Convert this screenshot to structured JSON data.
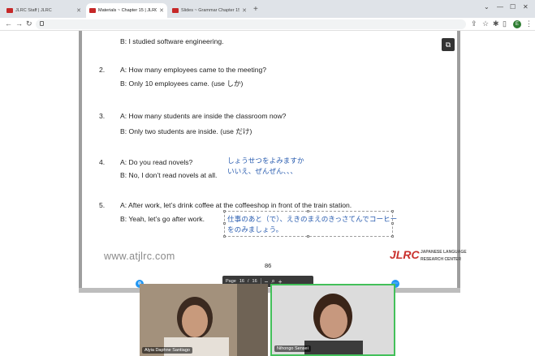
{
  "tabs": [
    {
      "title": "JLRC Staff | JLRC"
    },
    {
      "title": "Materials ~ Chapter 15 | JLRC"
    },
    {
      "title": "Slides ~ Grammar Chapter 15 | JLRC"
    }
  ],
  "profile_initial": "E",
  "document": {
    "top_line": "B: I studied software engineering.",
    "items": [
      {
        "num": "2.",
        "a": "A: How many employees came to the meeting?",
        "b": "B: Only 10 employees came. (use しか)"
      },
      {
        "num": "3.",
        "a": "A: How many students are inside the classroom now?",
        "b": "B: Only two students are inside. (use だけ)"
      },
      {
        "num": "4.",
        "a": "A: Do you read novels?",
        "b": "B: No, I don’t read novels at all."
      },
      {
        "num": "5.",
        "a": "A: After work, let’s drink coffee at the coffeeshop in front of the train station.",
        "b": "B: Yeah, let’s go after work."
      }
    ],
    "handwriting_4_line1": "しょうせつをよみますか",
    "handwriting_4_line2": "いいえ、ぜんぜん、、、",
    "handwriting_5_line1": "仕事のあと（で）、えきのまえのきっさてんでコーヒー",
    "handwriting_5_line2": "をのみましょう。",
    "website": "www.atjlrc.com",
    "page_number": "86",
    "logo_main": "JLRC",
    "logo_line1": "JAPANESE LANGUAGE",
    "logo_line2": "RESEARCH CENTER"
  },
  "page_control": {
    "label": "Page",
    "current": "16",
    "sep": "/",
    "total": "16",
    "minus": "−",
    "plus": "+"
  },
  "participants": [
    {
      "name": "Alyia Daphne Santiago"
    },
    {
      "name": "Nihongo Sensei"
    }
  ],
  "colors": {
    "accent_red": "#c9302c",
    "handwriting_blue": "#2a5db0",
    "active_speaker_green": "#43c05a"
  }
}
